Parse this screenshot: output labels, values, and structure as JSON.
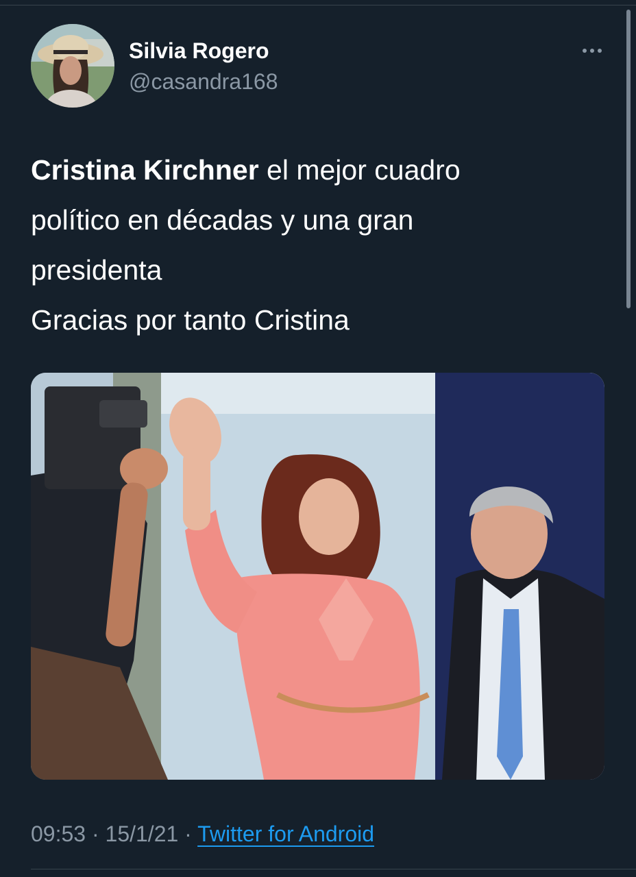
{
  "tweet": {
    "author": {
      "display_name": "Silvia Rogero",
      "handle": "@casandra168"
    },
    "text": {
      "line1_bold": "Cristina Kirchner",
      "line1_rest": " el mejor cuadro",
      "line2": "político en décadas y una gran",
      "line3": "presidenta",
      "line4": "Gracias por tanto Cristina"
    },
    "meta": {
      "time": "09:53",
      "sep1": " · ",
      "date": "15/1/21",
      "sep2": " · ",
      "source": "Twitter for Android"
    }
  },
  "icons": {
    "more": "more-options-icon"
  },
  "colors": {
    "background": "#15202b",
    "secondary_text": "#8b98a5",
    "link": "#1d9bf0",
    "divider": "#38444d"
  }
}
